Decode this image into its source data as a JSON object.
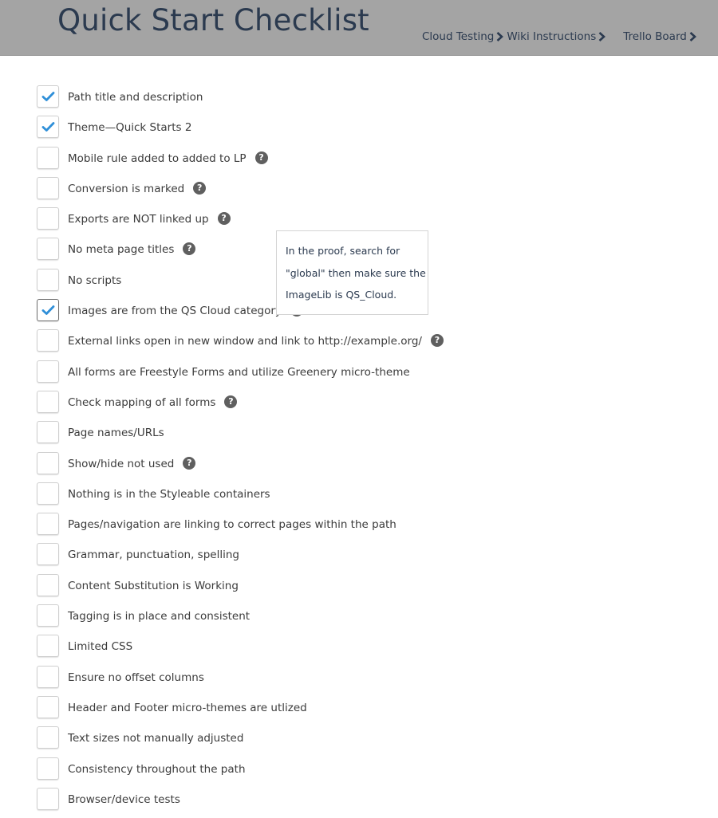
{
  "header": {
    "title": "Quick Start Checklist",
    "background_color": "#a4a4a4",
    "links": [
      {
        "label": "Cloud Testing",
        "icon": "chevron-right-icon"
      },
      {
        "label": "Wiki Instructions",
        "icon": "chevron-right-icon"
      },
      {
        "label": "Trello Board",
        "icon": "chevron-right-icon"
      }
    ]
  },
  "checklist": {
    "check_color": "#2f8fd8",
    "items": [
      {
        "label": "Path title and description",
        "checked": true,
        "help": false
      },
      {
        "label": "Theme—Quick Starts 2",
        "checked": true,
        "help": false
      },
      {
        "label": "Mobile rule added to added to LP",
        "checked": false,
        "help": true
      },
      {
        "label": "Conversion is marked",
        "checked": false,
        "help": true
      },
      {
        "label": "Exports are NOT linked up",
        "checked": false,
        "help": true
      },
      {
        "label": "No meta page titles",
        "checked": false,
        "help": true
      },
      {
        "label": "No scripts",
        "checked": false,
        "help": false
      },
      {
        "label": "Images are from the QS Cloud category",
        "checked": true,
        "help": true,
        "focused": true
      },
      {
        "label": "External links open in new window and link to http://example.org/",
        "checked": false,
        "help": true
      },
      {
        "label": "All forms are Freestyle Forms and utilize Greenery micro-theme",
        "checked": false,
        "help": false
      },
      {
        "label": "Check mapping of all forms",
        "checked": false,
        "help": true
      },
      {
        "label": "Page names/URLs",
        "checked": false,
        "help": false
      },
      {
        "label": "Show/hide not used",
        "checked": false,
        "help": true
      },
      {
        "label": "Nothing is in the Styleable containers",
        "checked": false,
        "help": false
      },
      {
        "label": "Pages/navigation are linking to correct pages within the path",
        "checked": false,
        "help": false
      },
      {
        "label": "Grammar, punctuation, spelling",
        "checked": false,
        "help": false
      },
      {
        "label": "Content Substitution is Working",
        "checked": false,
        "help": false
      },
      {
        "label": "Tagging is in place and consistent",
        "checked": false,
        "help": false
      },
      {
        "label": "Limited CSS",
        "checked": false,
        "help": false
      },
      {
        "label": "Ensure no offset columns",
        "checked": false,
        "help": false
      },
      {
        "label": "Header and Footer micro-themes are utlized",
        "checked": false,
        "help": false
      },
      {
        "label": "Text sizes not manually adjusted",
        "checked": false,
        "help": false
      },
      {
        "label": "Consistency throughout the path",
        "checked": false,
        "help": false
      },
      {
        "label": "Browser/device tests",
        "checked": false,
        "help": false
      }
    ]
  },
  "tooltip": {
    "lines": [
      "In the proof, search for",
      "\"global\" then make sure the",
      "ImageLib is QS_Cloud."
    ]
  },
  "icons": {
    "help_icon_glyph": "?",
    "check_icon": "checkmark-icon"
  }
}
